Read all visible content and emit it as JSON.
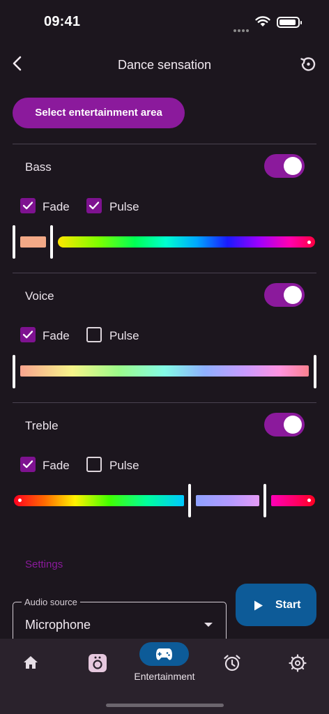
{
  "status_bar": {
    "time": "09:41",
    "signal_icon": "signal-dots-icon",
    "wifi_icon": "wifi-icon",
    "battery_icon": "battery-icon"
  },
  "header": {
    "title": "Dance sensation",
    "back_icon": "chevron-left-icon",
    "reset_icon": "history-reset-icon"
  },
  "area_button": {
    "label": "Select entertainment area"
  },
  "sections": [
    {
      "label": "Bass",
      "enabled": true,
      "fade": {
        "label": "Fade",
        "checked": true
      },
      "pulse": {
        "label": "Pulse",
        "checked": true
      }
    },
    {
      "label": "Voice",
      "enabled": true,
      "fade": {
        "label": "Fade",
        "checked": true
      },
      "pulse": {
        "label": "Pulse",
        "checked": false
      }
    },
    {
      "label": "Treble",
      "enabled": true,
      "fade": {
        "label": "Fade",
        "checked": true
      },
      "pulse": {
        "label": "Pulse",
        "checked": false
      }
    }
  ],
  "settings": {
    "heading": "Settings",
    "audio_source": {
      "label": "Audio source",
      "value": "Microphone"
    }
  },
  "start_button": {
    "label": "Start",
    "icon": "play-icon"
  },
  "bottom_nav": {
    "items": [
      {
        "icon": "home-icon",
        "label": ""
      },
      {
        "icon": "light-device-icon",
        "label": ""
      },
      {
        "icon": "gamepad-icon",
        "label": "Entertainment",
        "active": true
      },
      {
        "icon": "alarm-clock-icon",
        "label": ""
      },
      {
        "icon": "settings-gear-icon",
        "label": ""
      }
    ]
  },
  "colors": {
    "accent": "#8b1a9c",
    "primary_blue": "#0d5b98",
    "background": "#1c161e"
  }
}
